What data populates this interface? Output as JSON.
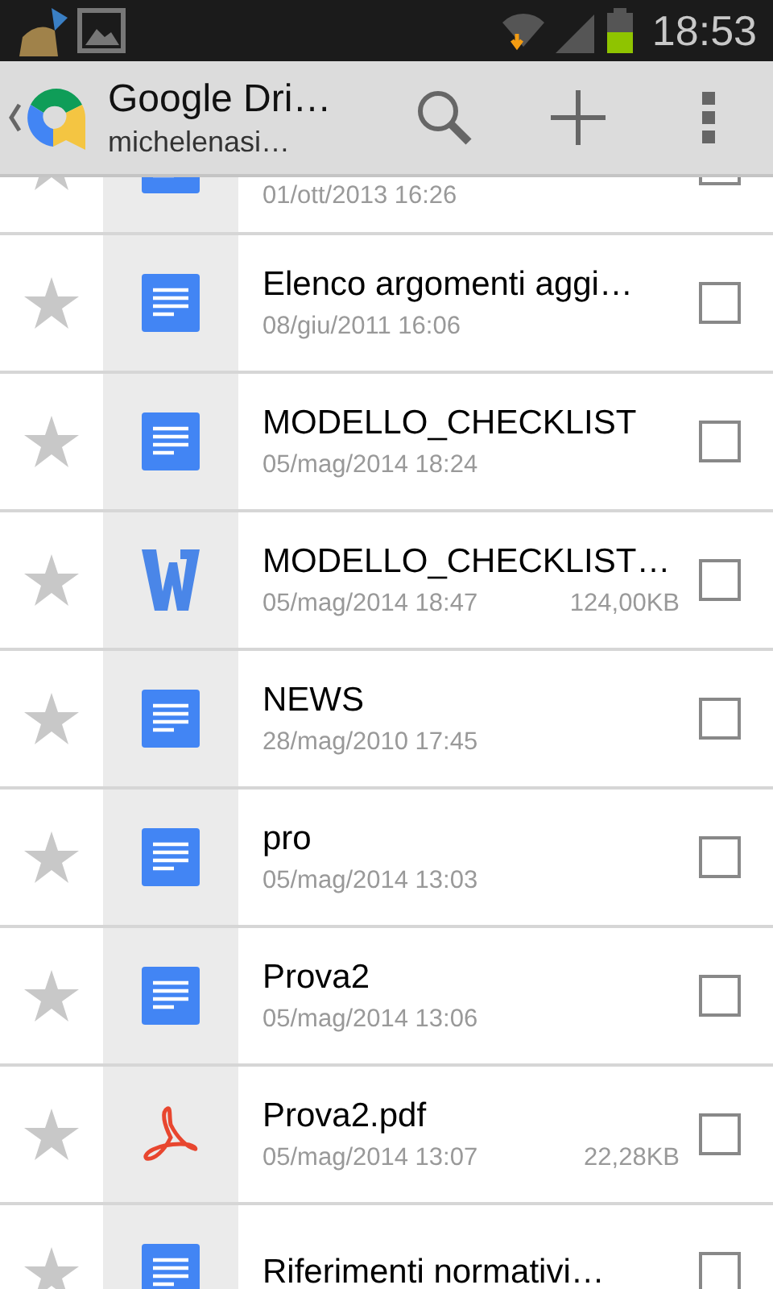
{
  "status_bar": {
    "time": "18:53"
  },
  "action_bar": {
    "title": "Google Dri…",
    "subtitle": "michelenasi…"
  },
  "files": [
    {
      "kind": "doc",
      "date": "01/ott/2013 16:26",
      "starred": false,
      "checked": false
    },
    {
      "kind": "doc",
      "name": "Elenco argomenti aggi…",
      "date": "08/giu/2011 16:06",
      "starred": false,
      "checked": false
    },
    {
      "kind": "doc",
      "name": "MODELLO_CHECKLIST",
      "date": "05/mag/2014 18:24",
      "starred": false,
      "checked": false
    },
    {
      "kind": "word",
      "name": "MODELLO_CHECKLIST…",
      "date": "05/mag/2014 18:47",
      "size": "124,00KB",
      "starred": false,
      "checked": false
    },
    {
      "kind": "doc",
      "name": "NEWS",
      "date": "28/mag/2010 17:45",
      "starred": false,
      "checked": false
    },
    {
      "kind": "doc",
      "name": "pro",
      "date": "05/mag/2014 13:03",
      "starred": false,
      "checked": false
    },
    {
      "kind": "doc",
      "name": "Prova2",
      "date": "05/mag/2014 13:06",
      "starred": false,
      "checked": false
    },
    {
      "kind": "pdf",
      "name": "Prova2.pdf",
      "date": "05/mag/2014 13:07",
      "size": "22,28KB",
      "starred": false,
      "checked": false
    },
    {
      "kind": "doc",
      "name": "Riferimenti normativi…",
      "starred": false,
      "checked": false
    }
  ]
}
